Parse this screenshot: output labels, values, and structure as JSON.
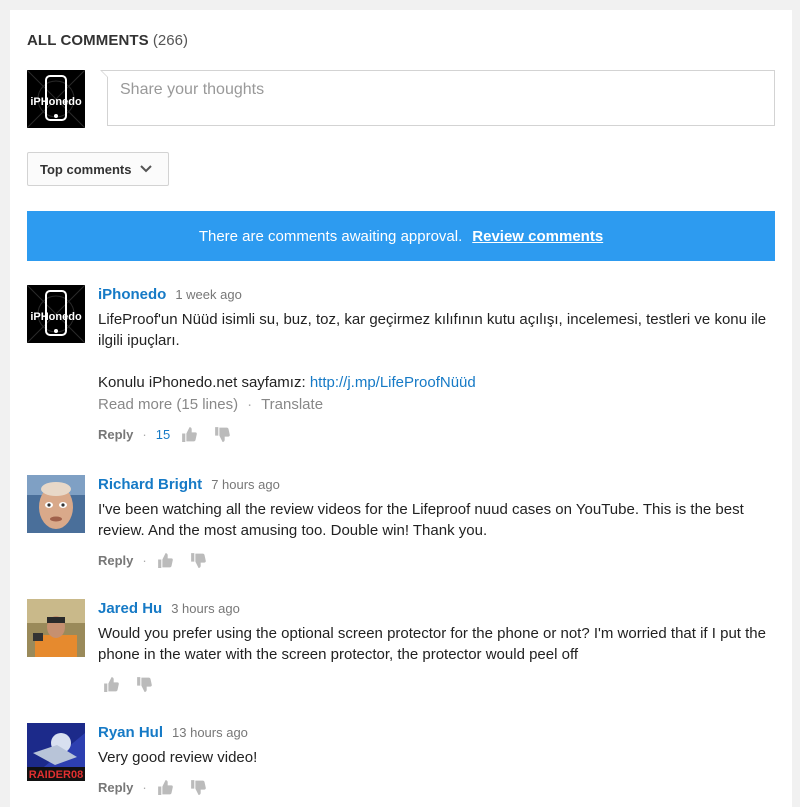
{
  "header": {
    "title": "ALL COMMENTS",
    "count": "(266)"
  },
  "share": {
    "placeholder": "Share your thoughts"
  },
  "sort": {
    "label": "Top comments"
  },
  "approval": {
    "message": "There are comments awaiting approval.",
    "link": "Review comments",
    "bg_color": "#2d9bf0"
  },
  "avatar_brand": {
    "text": "iPHonedo"
  },
  "comments": [
    {
      "author": "iPhonedo",
      "time": "1 week ago",
      "text_line1": "LifeProof'un Nüüd isimli su, buz, toz, kar geçirmez kılıfının kutu açılışı, incelemesi, testleri ve konu ile ilgili ipuçları.",
      "text_line2_prefix": "Konulu iPhonedo.net sayfamız:",
      "text_link": "http://j.mp/LifeProofNüüd",
      "read_more": "Read more (15 lines)",
      "translate": "Translate",
      "reply": "Reply",
      "likes": "15"
    },
    {
      "author": "Richard Bright",
      "time": "7 hours ago",
      "text": "I've been watching all the review videos for the Lifeproof nuud cases on YouTube. This is the best review. And the most amusing too. Double win! Thank you.",
      "reply": "Reply"
    },
    {
      "author": "Jared Hu",
      "time": "3 hours ago",
      "text": "Would you prefer using the optional screen protector for the phone or not? I'm worried that if I put the phone in the water with the screen protector, the protector would peel off"
    },
    {
      "author": "Ryan Hul",
      "time": "13 hours ago",
      "text": "Very good review video!",
      "reply": "Reply",
      "avatar_text": "RAIDER08"
    }
  ],
  "colors": {
    "link": "#167ac6",
    "meta": "#777777"
  }
}
